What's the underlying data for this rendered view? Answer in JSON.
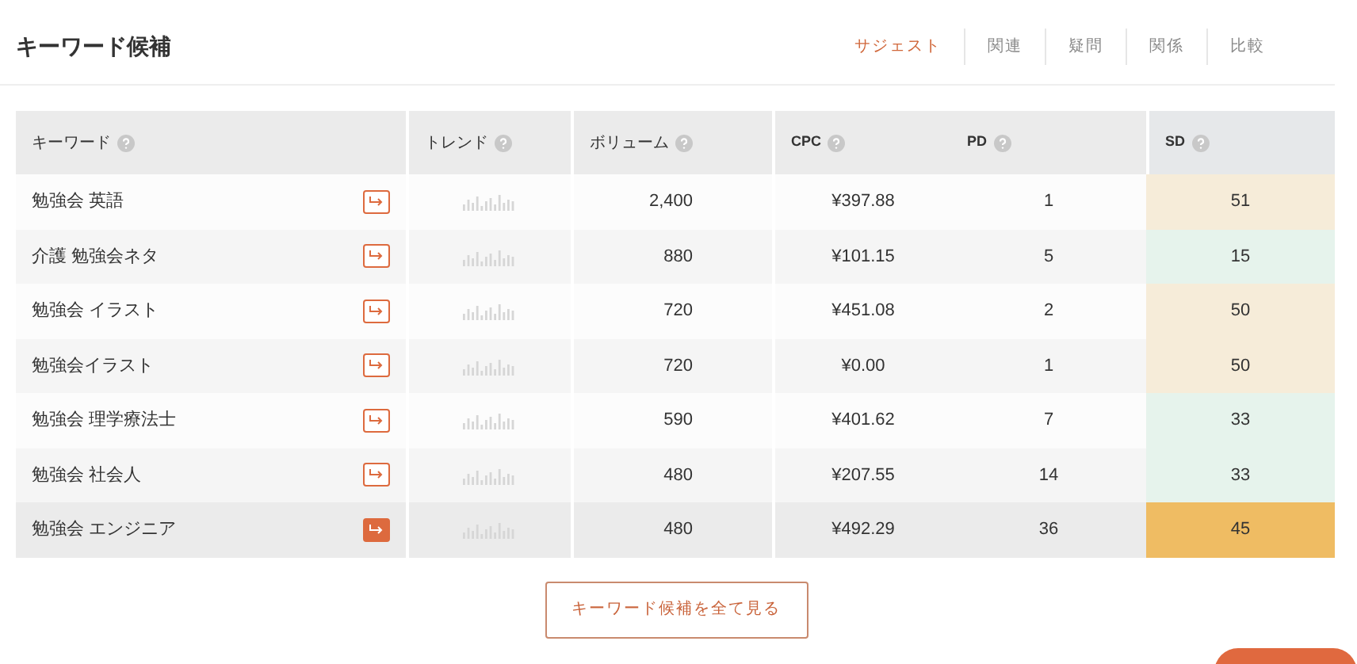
{
  "title": "キーワード候補",
  "tabs": [
    {
      "label": "サジェスト",
      "selected": true
    },
    {
      "label": "関連",
      "selected": false
    },
    {
      "label": "疑問",
      "selected": false
    },
    {
      "label": "関係",
      "selected": false
    },
    {
      "label": "比較",
      "selected": false
    }
  ],
  "table": {
    "columns": [
      "キーワード",
      "トレンド",
      "ボリューム",
      "CPC",
      "PD",
      "SD"
    ],
    "rows": [
      {
        "keyword": "勉強会 英語",
        "volume": "2,400",
        "cpc": "¥397.88",
        "pd": "1",
        "sd": "51",
        "color": "#f6ecd9",
        "selected": false
      },
      {
        "keyword": "介護 勉強会ネタ",
        "volume": "880",
        "cpc": "¥101.15",
        "pd": "5",
        "sd": "15",
        "color": "#e6f3ec",
        "selected": false
      },
      {
        "keyword": "勉強会 イラスト",
        "volume": "720",
        "cpc": "¥451.08",
        "pd": "2",
        "sd": "50",
        "color": "#f6ecd9",
        "selected": false
      },
      {
        "keyword": "勉強会イラスト",
        "volume": "720",
        "cpc": "¥0.00",
        "pd": "1",
        "sd": "50",
        "color": "#f6ecd9",
        "selected": false
      },
      {
        "keyword": "勉強会 理学療法士",
        "volume": "590",
        "cpc": "¥401.62",
        "pd": "7",
        "sd": "33",
        "color": "#e6f3ec",
        "selected": false
      },
      {
        "keyword": "勉強会 社会人",
        "volume": "480",
        "cpc": "¥207.55",
        "pd": "14",
        "sd": "33",
        "color": "#e6f3ec",
        "selected": false
      },
      {
        "keyword": "勉強会 エンジニア",
        "volume": "480",
        "cpc": "¥492.29",
        "pd": "36",
        "sd": "45",
        "color": "#efbc63",
        "selected": true
      }
    ]
  },
  "more_button": "キーワード候補を全て見る"
}
